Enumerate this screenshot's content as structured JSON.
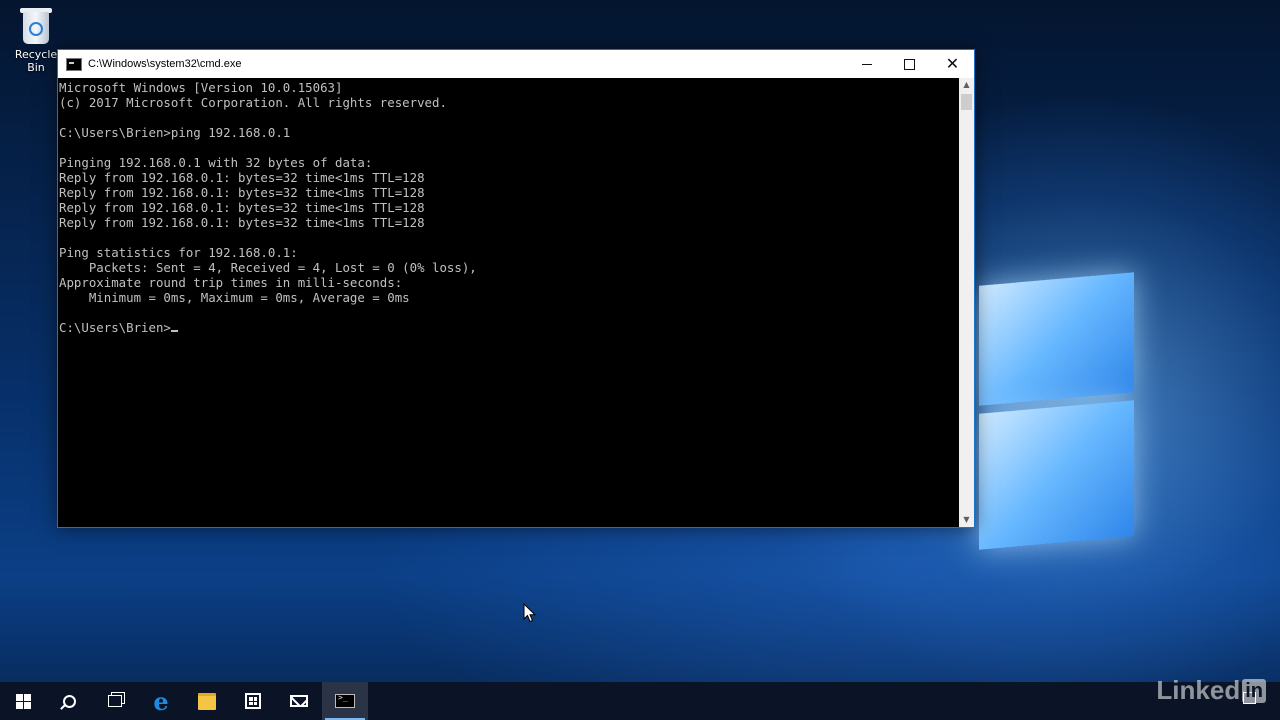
{
  "desktop": {
    "icons": [
      {
        "label": "Recycle Bin",
        "icon": "recycle-bin-icon"
      }
    ]
  },
  "window": {
    "title": "C:\\Windows\\system32\\cmd.exe",
    "icon": "cmd-icon",
    "controls": {
      "minimize": "minimize-icon",
      "maximize": "maximize-icon",
      "close": "close-icon"
    }
  },
  "console": {
    "lines": [
      "Microsoft Windows [Version 10.0.15063]",
      "(c) 2017 Microsoft Corporation. All rights reserved.",
      "",
      "C:\\Users\\Brien>ping 192.168.0.1",
      "",
      "Pinging 192.168.0.1 with 32 bytes of data:",
      "Reply from 192.168.0.1: bytes=32 time<1ms TTL=128",
      "Reply from 192.168.0.1: bytes=32 time<1ms TTL=128",
      "Reply from 192.168.0.1: bytes=32 time<1ms TTL=128",
      "Reply from 192.168.0.1: bytes=32 time<1ms TTL=128",
      "",
      "Ping statistics for 192.168.0.1:",
      "    Packets: Sent = 4, Received = 4, Lost = 0 (0% loss),",
      "Approximate round trip times in milli-seconds:",
      "    Minimum = 0ms, Maximum = 0ms, Average = 0ms",
      ""
    ],
    "prompt": "C:\\Users\\Brien>",
    "text_color": "#c0c0c0",
    "background": "#000000"
  },
  "taskbar": {
    "items": [
      {
        "name": "start",
        "icon": "windows-start-icon"
      },
      {
        "name": "search",
        "icon": "search-icon"
      },
      {
        "name": "task-view",
        "icon": "task-view-icon"
      },
      {
        "name": "edge",
        "icon": "edge-browser-icon",
        "glyph": "e"
      },
      {
        "name": "file-explorer",
        "icon": "folder-icon"
      },
      {
        "name": "store",
        "icon": "store-icon"
      },
      {
        "name": "mail",
        "icon": "mail-icon"
      },
      {
        "name": "command-prompt",
        "icon": "cmd-icon",
        "active": true
      }
    ],
    "accent": "#7cb8f2"
  },
  "watermark": {
    "text": "Linked",
    "badge": "in"
  }
}
